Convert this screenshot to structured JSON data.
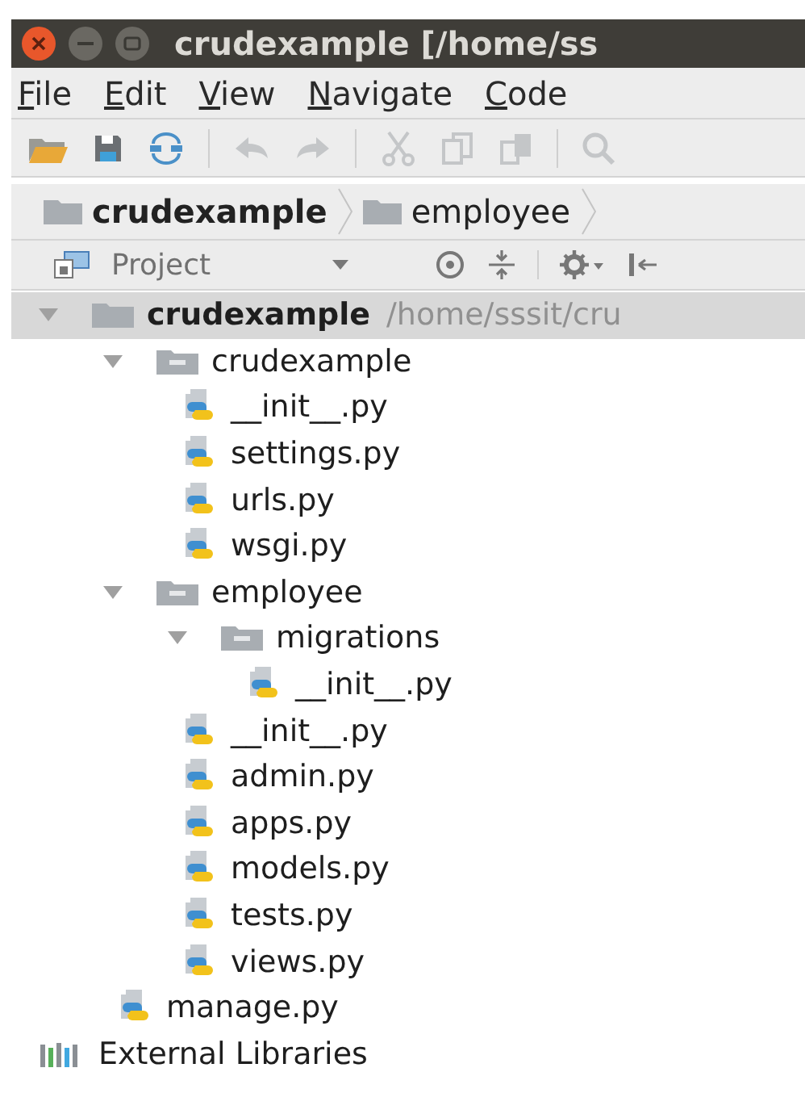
{
  "window": {
    "title": "crudexample [/home/ss"
  },
  "menu": [
    "File",
    "Edit",
    "View",
    "Navigate",
    "Code"
  ],
  "breadcrumb": [
    {
      "label": "crudexample",
      "bold": true
    },
    {
      "label": "employee",
      "bold": false
    }
  ],
  "panel": {
    "title": "Project"
  },
  "tree": [
    {
      "kind": "project",
      "label": "crudexample",
      "path": "/home/sssit/cru",
      "expanded": true,
      "selected": true,
      "children": [
        {
          "kind": "folder",
          "label": "crudexample",
          "expanded": true,
          "selected": false,
          "children": [
            {
              "kind": "file",
              "label": "__init__.py",
              "selected": false
            },
            {
              "kind": "file",
              "label": "settings.py",
              "selected": false
            },
            {
              "kind": "file",
              "label": "urls.py",
              "selected": false
            },
            {
              "kind": "file",
              "label": "wsgi.py",
              "selected": false
            }
          ]
        },
        {
          "kind": "folder",
          "label": "employee",
          "expanded": true,
          "selected": false,
          "children": [
            {
              "kind": "folder",
              "label": "migrations",
              "expanded": true,
              "selected": false,
              "children": [
                {
                  "kind": "file",
                  "label": "__init__.py",
                  "selected": false
                }
              ]
            },
            {
              "kind": "file",
              "label": "__init__.py",
              "selected": false
            },
            {
              "kind": "file",
              "label": "admin.py",
              "selected": false
            },
            {
              "kind": "file",
              "label": "apps.py",
              "selected": false
            },
            {
              "kind": "file",
              "label": "models.py",
              "selected": false
            },
            {
              "kind": "file",
              "label": "tests.py",
              "selected": false
            },
            {
              "kind": "file",
              "label": "views.py",
              "selected": false
            }
          ]
        },
        {
          "kind": "file",
          "label": "manage.py",
          "selected": false
        }
      ]
    },
    {
      "kind": "libraries",
      "label": "External Libraries",
      "selected": false
    }
  ]
}
